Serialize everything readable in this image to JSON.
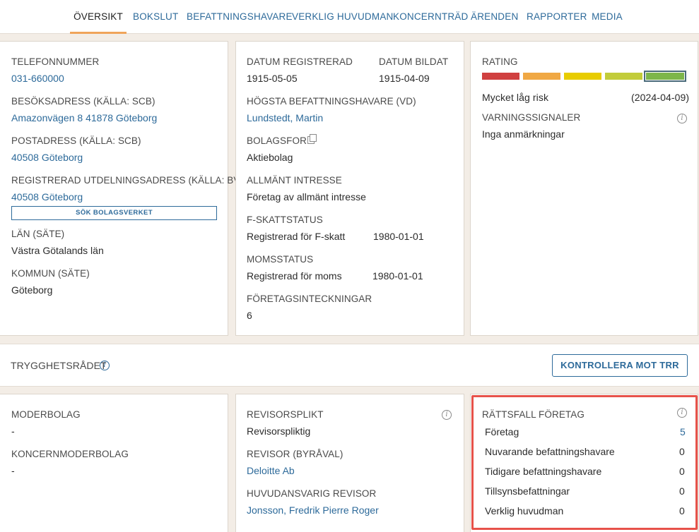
{
  "nav": {
    "tabs": [
      {
        "label": "ÖVERSIKT",
        "active": true
      },
      {
        "label": "BOKSLUT"
      },
      {
        "label": "BEFATTNINGSHAVARE"
      },
      {
        "label": "VERKLIG HUVUDMAN"
      },
      {
        "label": "KONCERNTRÄD"
      },
      {
        "label": "ÄRENDEN"
      },
      {
        "label": "RAPPORTER"
      },
      {
        "label": "MEDIA"
      }
    ]
  },
  "contact": {
    "phone_label": "TELEFONNUMMER",
    "phone": "031-660000",
    "visit_label": "BESÖKSADRESS (KÄLLA: SCB)",
    "visit": "Amazonvägen 8 41878 Göteborg",
    "postal_label": "POSTADRESS (KÄLLA: SCB)",
    "postal": "40508 Göteborg",
    "reg_label": "REGISTRERAD UTDELNINGSADRESS (KÄLLA: BV)",
    "reg": "40508 Göteborg",
    "search_button": "SÖK BOLAGSVERKET",
    "lan_label": "LÄN (SÄTE)",
    "lan": "Västra Götalands län",
    "kommun_label": "KOMMUN (SÄTE)",
    "kommun": "Göteborg"
  },
  "company": {
    "registered_label": "DATUM REGISTRERAD",
    "registered": "1915-05-05",
    "founded_label": "DATUM BILDAT",
    "founded": "1915-04-09",
    "ceo_label": "HÖGSTA BEFATTNINGSHAVARE (VD)",
    "ceo": "Lundstedt, Martin",
    "form_label": "BOLAGSFORM",
    "form": "Aktiebolag",
    "interest_label": "ALLMÄNT INTRESSE",
    "interest": "Företag av allmänt intresse",
    "ftax_label": "F-SKATTSTATUS",
    "ftax": "Registrerad för F-skatt",
    "ftax_date": "1980-01-01",
    "vat_label": "MOMSSTATUS",
    "vat": "Registrerad för moms",
    "vat_date": "1980-01-01",
    "mortgage_label": "FÖRETAGSINTECKNINGAR",
    "mortgage": "6"
  },
  "rating": {
    "label": "RATING",
    "segments": [
      "#d04040",
      "#f0a844",
      "#e8cc00",
      "#c2cc3a",
      "#7db64a"
    ],
    "selected_index": 4,
    "risk": "Mycket låg risk",
    "date": "(2024-04-09)",
    "warnings_label": "VARNINGSSIGNALER",
    "warnings": "Inga anmärkningar"
  },
  "trr": {
    "title": "TRYGGHETSRÅDET",
    "button": "KONTROLLERA MOT TRR"
  },
  "group": {
    "parent_label": "MODERBOLAG",
    "parent": "-",
    "group_parent_label": "KONCERNMODERBOLAG",
    "group_parent": "-"
  },
  "audit": {
    "duty_label": "REVISORSPLIKT",
    "duty": "Revisorspliktig",
    "auditor_label": "REVISOR (BYRÅVAL)",
    "auditor": "Deloitte Ab",
    "lead_label": "HUVUDANSVARIG REVISOR",
    "lead": "Jonsson, Fredrik Pierre Roger"
  },
  "legal": {
    "title": "RÄTTSFALL FÖRETAG",
    "rows": [
      {
        "label": "Företag",
        "count": "5"
      },
      {
        "label": "Nuvarande befattningshavare",
        "count": "0"
      },
      {
        "label": "Tidigare befattningshavare",
        "count": "0"
      },
      {
        "label": "Tillsynsbefattningar",
        "count": "0"
      },
      {
        "label": "Verklig huvudman",
        "count": "0"
      }
    ]
  },
  "colors": {
    "accent": "#2d6a9a",
    "active_tab_underline": "#f0a45a",
    "highlight_border": "#e7524a",
    "background": "#f3ede6"
  }
}
